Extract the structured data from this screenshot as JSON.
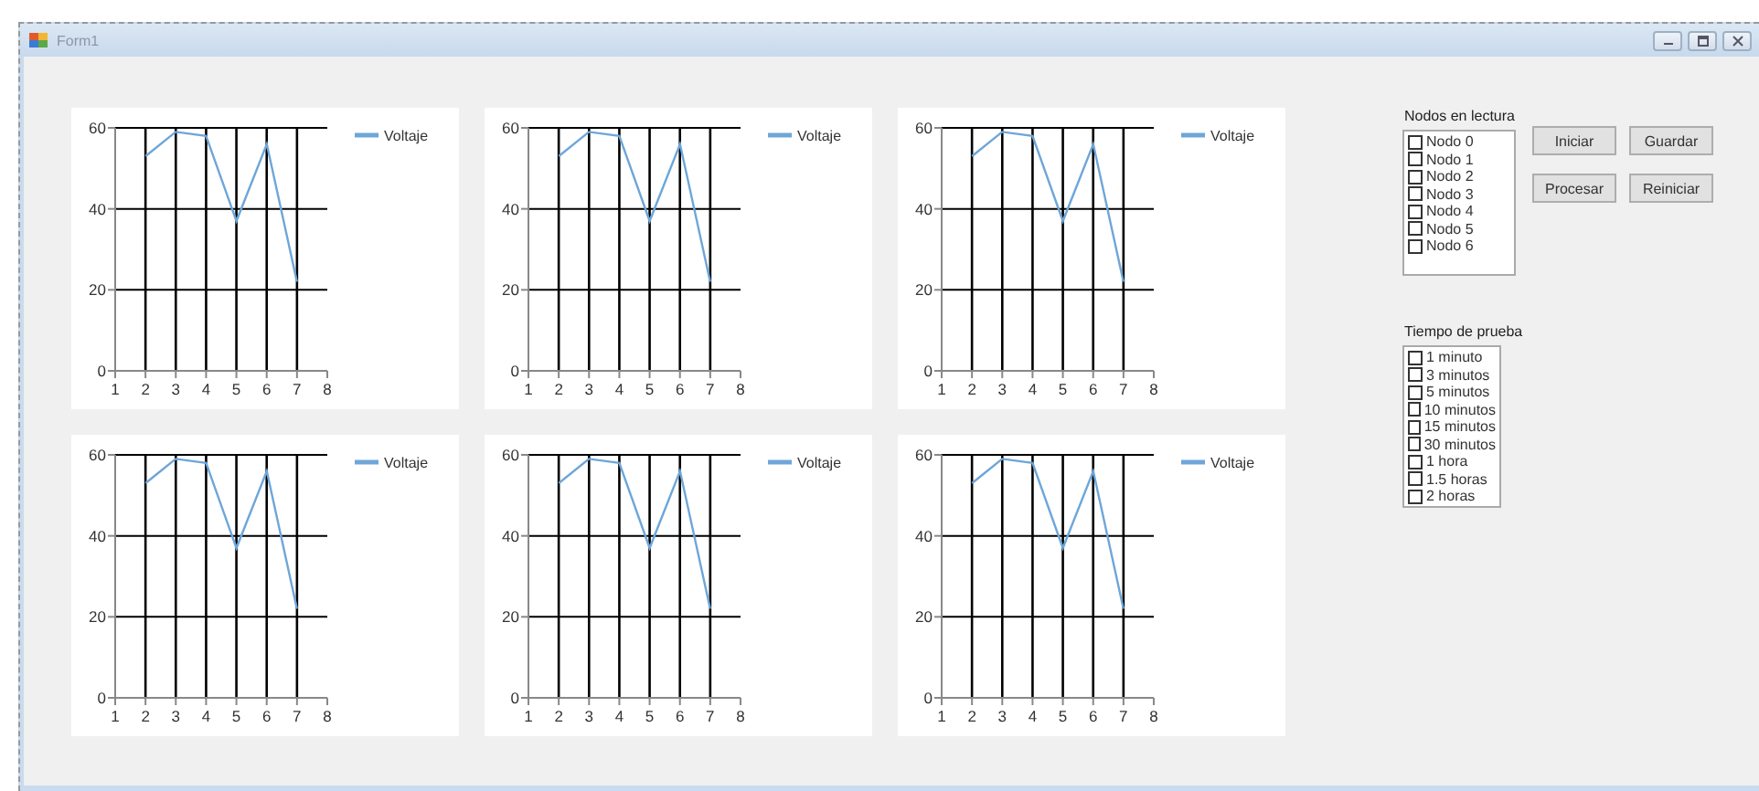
{
  "window": {
    "title": "Form1"
  },
  "charts": [
    {
      "chart_data": {
        "type": "line",
        "x": [
          2,
          3,
          4,
          5,
          6,
          7
        ],
        "series": [
          {
            "name": "Voltaje",
            "color": "#6ea6d8",
            "values": [
              53,
              59,
              58,
              37,
              56,
              22
            ]
          }
        ],
        "xlim": [
          1,
          8
        ],
        "ylim": [
          0,
          60
        ],
        "xticks": [
          1,
          2,
          3,
          4,
          5,
          6,
          7,
          8
        ],
        "yticks": [
          0,
          20,
          40,
          60
        ],
        "grid": true
      }
    },
    {
      "chart_data": {
        "type": "line",
        "x": [
          2,
          3,
          4,
          5,
          6,
          7
        ],
        "series": [
          {
            "name": "Voltaje",
            "color": "#6ea6d8",
            "values": [
              53,
              59,
              58,
              37,
              56,
              22
            ]
          }
        ],
        "xlim": [
          1,
          8
        ],
        "ylim": [
          0,
          60
        ],
        "xticks": [
          1,
          2,
          3,
          4,
          5,
          6,
          7,
          8
        ],
        "yticks": [
          0,
          20,
          40,
          60
        ],
        "grid": true
      }
    },
    {
      "chart_data": {
        "type": "line",
        "x": [
          2,
          3,
          4,
          5,
          6,
          7
        ],
        "series": [
          {
            "name": "Voltaje",
            "color": "#6ea6d8",
            "values": [
              53,
              59,
              58,
              37,
              56,
              22
            ]
          }
        ],
        "xlim": [
          1,
          8
        ],
        "ylim": [
          0,
          60
        ],
        "xticks": [
          1,
          2,
          3,
          4,
          5,
          6,
          7,
          8
        ],
        "yticks": [
          0,
          20,
          40,
          60
        ],
        "grid": true
      }
    },
    {
      "chart_data": {
        "type": "line",
        "x": [
          2,
          3,
          4,
          5,
          6,
          7
        ],
        "series": [
          {
            "name": "Voltaje",
            "color": "#6ea6d8",
            "values": [
              53,
              59,
              58,
              37,
              56,
              22
            ]
          }
        ],
        "xlim": [
          1,
          8
        ],
        "ylim": [
          0,
          60
        ],
        "xticks": [
          1,
          2,
          3,
          4,
          5,
          6,
          7,
          8
        ],
        "yticks": [
          0,
          20,
          40,
          60
        ],
        "grid": true
      }
    },
    {
      "chart_data": {
        "type": "line",
        "x": [
          2,
          3,
          4,
          5,
          6,
          7
        ],
        "series": [
          {
            "name": "Voltaje",
            "color": "#6ea6d8",
            "values": [
              53,
              59,
              58,
              37,
              56,
              22
            ]
          }
        ],
        "xlim": [
          1,
          8
        ],
        "ylim": [
          0,
          60
        ],
        "xticks": [
          1,
          2,
          3,
          4,
          5,
          6,
          7,
          8
        ],
        "yticks": [
          0,
          20,
          40,
          60
        ],
        "grid": true
      }
    },
    {
      "chart_data": {
        "type": "line",
        "x": [
          2,
          3,
          4,
          5,
          6,
          7
        ],
        "series": [
          {
            "name": "Voltaje",
            "color": "#6ea6d8",
            "values": [
              53,
              59,
              58,
              37,
              56,
              22
            ]
          }
        ],
        "xlim": [
          1,
          8
        ],
        "ylim": [
          0,
          60
        ],
        "xticks": [
          1,
          2,
          3,
          4,
          5,
          6,
          7,
          8
        ],
        "yticks": [
          0,
          20,
          40,
          60
        ],
        "grid": true
      }
    }
  ],
  "nodes_group": {
    "label": "Nodos en lectura",
    "items": [
      {
        "label": "Nodo 0",
        "checked": false
      },
      {
        "label": "Nodo 1",
        "checked": false
      },
      {
        "label": "Nodo 2",
        "checked": false
      },
      {
        "label": "Nodo 3",
        "checked": false
      },
      {
        "label": "Nodo 4",
        "checked": false
      },
      {
        "label": "Nodo 5",
        "checked": false
      },
      {
        "label": "Nodo 6",
        "checked": false
      }
    ]
  },
  "buttons": [
    {
      "label": "Iniciar"
    },
    {
      "label": "Guardar"
    },
    {
      "label": "Procesar"
    },
    {
      "label": "Reiniciar"
    }
  ],
  "time_group": {
    "label": "Tiempo de prueba",
    "items": [
      {
        "label": "1 minuto",
        "checked": false
      },
      {
        "label": "3 minutos",
        "checked": false
      },
      {
        "label": "5 minutos",
        "checked": false
      },
      {
        "label": "10 minutos",
        "checked": false
      },
      {
        "label": "15 minutos",
        "checked": false
      },
      {
        "label": "30 minutos",
        "checked": false
      },
      {
        "label": "1 hora",
        "checked": false
      },
      {
        "label": "1.5 horas",
        "checked": false
      },
      {
        "label": "2 horas",
        "checked": false
      }
    ]
  }
}
